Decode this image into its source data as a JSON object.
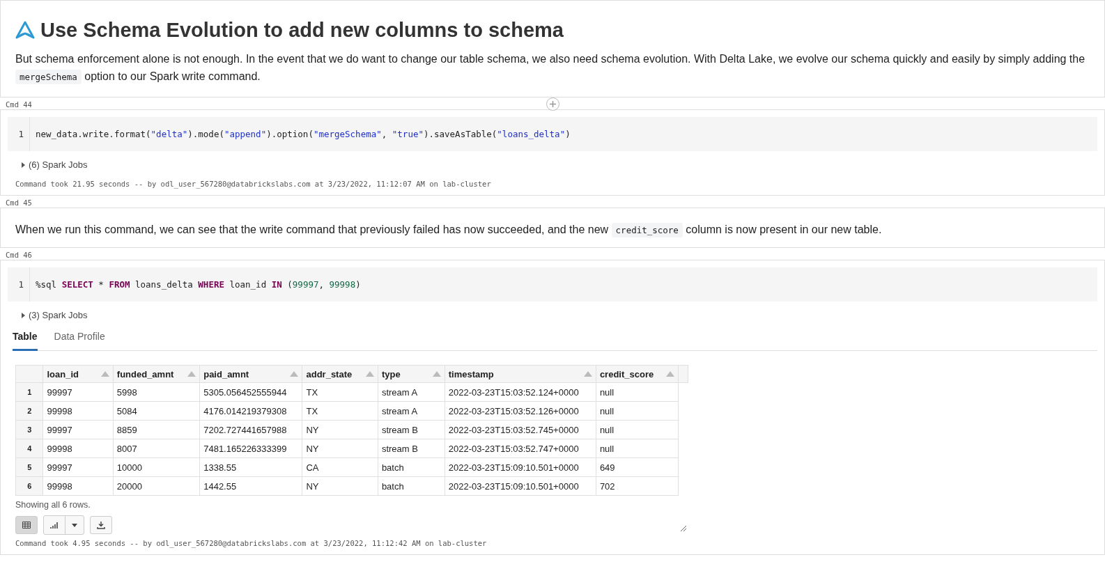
{
  "heading": "Use Schema Evolution to add new columns to schema",
  "intro": [
    {
      "kind": "text",
      "text": "But schema enforcement alone is not enough. In the event that we do want to change our table schema, we also need schema evolution. With Delta Lake, we evolve our schema quickly and easily by simply adding the "
    },
    {
      "kind": "code",
      "text": "mergeSchema"
    },
    {
      "kind": "text",
      "text": " option to our Spark write command."
    }
  ],
  "cells": [
    {
      "kind": "code",
      "label": "Cmd 44",
      "line_number": "1",
      "tokens": [
        {
          "kind": "plain",
          "text": "new_data.write.format("
        },
        {
          "kind": "string",
          "text": "\"delta\""
        },
        {
          "kind": "plain",
          "text": ").mode("
        },
        {
          "kind": "string",
          "text": "\"append\""
        },
        {
          "kind": "plain",
          "text": ").option("
        },
        {
          "kind": "string",
          "text": "\"mergeSchema\""
        },
        {
          "kind": "plain",
          "text": ", "
        },
        {
          "kind": "string",
          "text": "\"true\""
        },
        {
          "kind": "plain",
          "text": ").saveAsTable("
        },
        {
          "kind": "string",
          "text": "\"loans_delta\""
        },
        {
          "kind": "plain",
          "text": ")"
        }
      ],
      "jobs": "(6) Spark Jobs",
      "footer": "Command took 21.95 seconds -- by odl_user_567280@databrickslabs.com at 3/23/2022, 11:12:07 AM on lab-cluster"
    },
    {
      "kind": "markdown",
      "label": "Cmd 45",
      "segments": [
        {
          "kind": "text",
          "text": "When we run this command, we can see that the write command that previously failed has now succeeded, and the new "
        },
        {
          "kind": "code",
          "text": "credit_score"
        },
        {
          "kind": "text",
          "text": " column is now present in our new table."
        }
      ]
    },
    {
      "kind": "code",
      "label": "Cmd 46",
      "line_number": "1",
      "tokens": [
        {
          "kind": "plain",
          "text": "%sql "
        },
        {
          "kind": "keyword",
          "text": "SELECT"
        },
        {
          "kind": "plain",
          "text": " * "
        },
        {
          "kind": "keyword",
          "text": "FROM"
        },
        {
          "kind": "plain",
          "text": " loans_delta "
        },
        {
          "kind": "keyword",
          "text": "WHERE"
        },
        {
          "kind": "plain",
          "text": " loan_id "
        },
        {
          "kind": "keyword",
          "text": "IN"
        },
        {
          "kind": "plain",
          "text": " ("
        },
        {
          "kind": "number",
          "text": "99997"
        },
        {
          "kind": "plain",
          "text": ", "
        },
        {
          "kind": "number",
          "text": "99998"
        },
        {
          "kind": "plain",
          "text": ")"
        }
      ],
      "jobs": "(3) Spark Jobs",
      "tabs": [
        {
          "label": "Table",
          "selected": true
        },
        {
          "label": "Data Profile",
          "selected": false
        }
      ],
      "table": {
        "columns": [
          "",
          "loan_id",
          "funded_amnt",
          "paid_amnt",
          "addr_state",
          "type",
          "timestamp",
          "credit_score"
        ],
        "rows": [
          [
            "1",
            "99997",
            "5998",
            "5305.056452555944",
            "TX",
            "stream A",
            "2022-03-23T15:03:52.124+0000",
            "null"
          ],
          [
            "2",
            "99998",
            "5084",
            "4176.014219379308",
            "TX",
            "stream A",
            "2022-03-23T15:03:52.126+0000",
            "null"
          ],
          [
            "3",
            "99997",
            "8859",
            "7202.727441657988",
            "NY",
            "stream B",
            "2022-03-23T15:03:52.745+0000",
            "null"
          ],
          [
            "4",
            "99998",
            "8007",
            "7481.165226333399",
            "NY",
            "stream B",
            "2022-03-23T15:03:52.747+0000",
            "null"
          ],
          [
            "5",
            "99997",
            "10000",
            "1338.55",
            "CA",
            "batch",
            "2022-03-23T15:09:10.501+0000",
            "649"
          ],
          [
            "6",
            "99998",
            "20000",
            "1442.55",
            "NY",
            "batch",
            "2022-03-23T15:09:10.501+0000",
            "702"
          ]
        ]
      },
      "row_count": "Showing all 6 rows.",
      "view_table_selected": true,
      "footer": "Command took 4.95 seconds -- by odl_user_567280@databrickslabs.com at 3/23/2022, 11:12:42 AM on lab-cluster"
    }
  ]
}
